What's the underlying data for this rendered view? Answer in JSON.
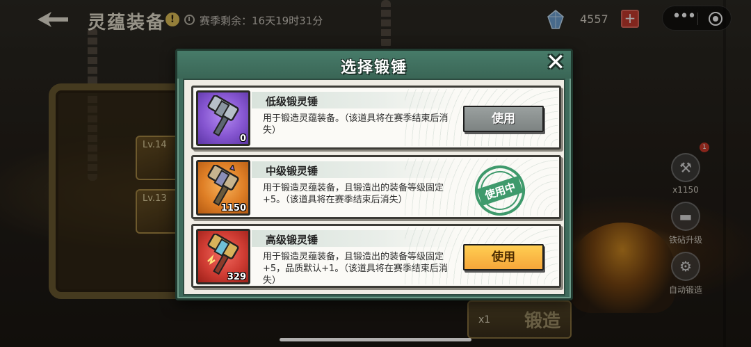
{
  "topbar": {
    "back_icon": "back-arrow-icon",
    "title": "灵蕴装备",
    "alert_icon": "!",
    "season_label": "赛季剩余：16天19时31分",
    "currency_icon": "crystal-icon",
    "currency_count": "4557",
    "plus_label": "+",
    "more_icon": "•••"
  },
  "background": {
    "slot1_label": "Lv.14",
    "slot2_label": "Lv.13",
    "forge_qty": "x1",
    "forge_label": "锻造"
  },
  "side_menu": {
    "badge": "1",
    "hammer_count": "x1150",
    "anvil_label": "铁砧升级",
    "auto_label": "自动锻造"
  },
  "modal": {
    "title": "选择锻锤",
    "close_label": "✕",
    "items": [
      {
        "name": "低级锻灵锤",
        "desc": "用于锻造灵蕴装备。（该道具将在赛季结束后消失）",
        "qty": "0",
        "action": "使用",
        "state": "available",
        "icon": "purple-hammer-icon",
        "color": "#8656d1"
      },
      {
        "name": "中级锻灵锤",
        "desc": "用于锻造灵蕴装备，且锻造出的装备等级固定+5。（该道具将在赛季结束后消失）",
        "qty": "1150",
        "action": "使用中",
        "state": "in-use",
        "icon": "orange-hammer-icon",
        "color": "#df7f26"
      },
      {
        "name": "高级锻灵锤",
        "desc": "用于锻造灵蕴装备，且锻造出的装备等级固定+5，品质默认+1。（该道具将在赛季结束后消失）",
        "qty": "329",
        "action": "使用",
        "state": "available",
        "icon": "red-hammer-icon",
        "color": "#cf3c33"
      }
    ]
  },
  "colors": {
    "modal_frame": "#3e6b5c",
    "button_gray": "#8b9190",
    "button_orange": "#f6a63a",
    "stamp_green": "#3f9a6c"
  }
}
